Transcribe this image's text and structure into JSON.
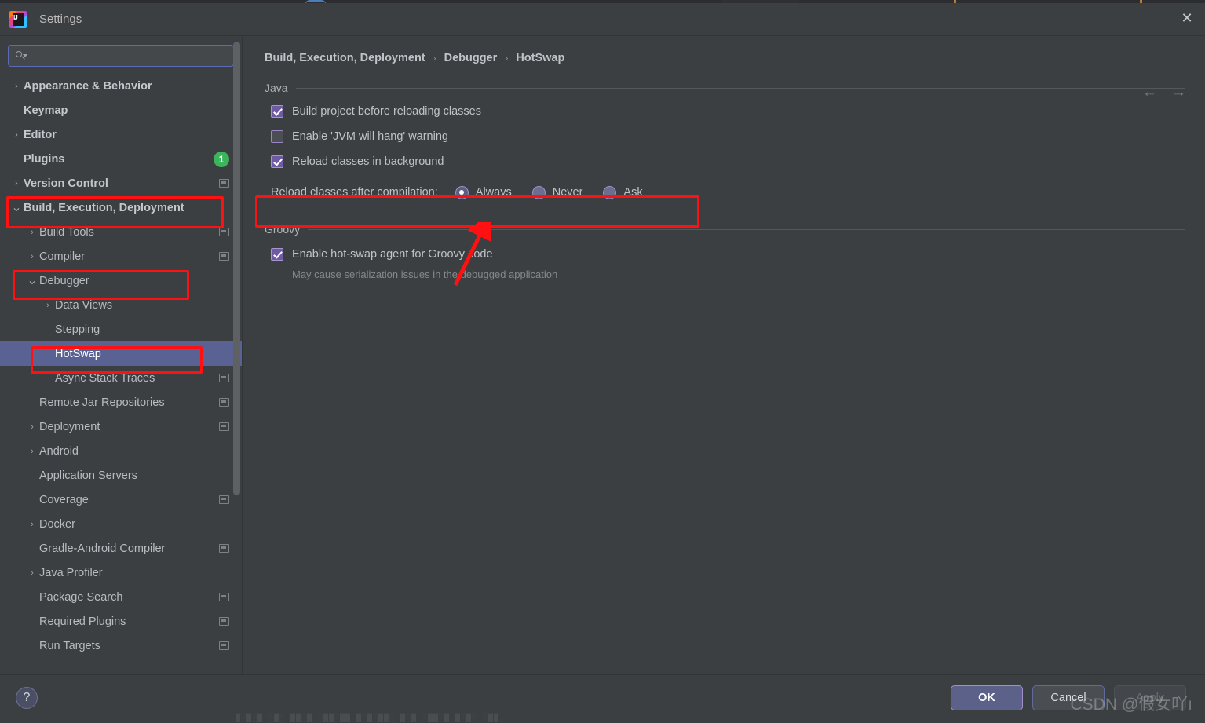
{
  "window": {
    "title": "Settings",
    "app_icon": "intellij-idea-icon",
    "close_icon": "close-icon"
  },
  "search": {
    "value": "",
    "placeholder": "",
    "icon": "search-icon"
  },
  "sidebar": {
    "items": [
      {
        "label": "Appearance & Behavior",
        "indent": 0,
        "arrow": "collapsed",
        "bold": true,
        "marker": false,
        "badge": null,
        "selected": false
      },
      {
        "label": "Keymap",
        "indent": 0,
        "arrow": "none",
        "bold": true,
        "marker": false,
        "badge": null,
        "selected": false
      },
      {
        "label": "Editor",
        "indent": 0,
        "arrow": "collapsed",
        "bold": true,
        "marker": false,
        "badge": null,
        "selected": false
      },
      {
        "label": "Plugins",
        "indent": 0,
        "arrow": "none",
        "bold": true,
        "marker": false,
        "badge": "1",
        "selected": false
      },
      {
        "label": "Version Control",
        "indent": 0,
        "arrow": "collapsed",
        "bold": true,
        "marker": true,
        "badge": null,
        "selected": false
      },
      {
        "label": "Build, Execution, Deployment",
        "indent": 0,
        "arrow": "expanded",
        "bold": true,
        "marker": false,
        "badge": null,
        "selected": false
      },
      {
        "label": "Build Tools",
        "indent": 1,
        "arrow": "collapsed",
        "bold": false,
        "marker": true,
        "badge": null,
        "selected": false
      },
      {
        "label": "Compiler",
        "indent": 1,
        "arrow": "collapsed",
        "bold": false,
        "marker": true,
        "badge": null,
        "selected": false
      },
      {
        "label": "Debugger",
        "indent": 1,
        "arrow": "expanded",
        "bold": false,
        "marker": false,
        "badge": null,
        "selected": false
      },
      {
        "label": "Data Views",
        "indent": 2,
        "arrow": "collapsed",
        "bold": false,
        "marker": false,
        "badge": null,
        "selected": false
      },
      {
        "label": "Stepping",
        "indent": 2,
        "arrow": "none",
        "bold": false,
        "marker": false,
        "badge": null,
        "selected": false
      },
      {
        "label": "HotSwap",
        "indent": 2,
        "arrow": "none",
        "bold": false,
        "marker": false,
        "badge": null,
        "selected": true
      },
      {
        "label": "Async Stack Traces",
        "indent": 2,
        "arrow": "none",
        "bold": false,
        "marker": true,
        "badge": null,
        "selected": false
      },
      {
        "label": "Remote Jar Repositories",
        "indent": 1,
        "arrow": "none",
        "bold": false,
        "marker": true,
        "badge": null,
        "selected": false
      },
      {
        "label": "Deployment",
        "indent": 1,
        "arrow": "collapsed",
        "bold": false,
        "marker": true,
        "badge": null,
        "selected": false
      },
      {
        "label": "Android",
        "indent": 1,
        "arrow": "collapsed",
        "bold": false,
        "marker": false,
        "badge": null,
        "selected": false
      },
      {
        "label": "Application Servers",
        "indent": 1,
        "arrow": "none",
        "bold": false,
        "marker": false,
        "badge": null,
        "selected": false
      },
      {
        "label": "Coverage",
        "indent": 1,
        "arrow": "none",
        "bold": false,
        "marker": true,
        "badge": null,
        "selected": false
      },
      {
        "label": "Docker",
        "indent": 1,
        "arrow": "collapsed",
        "bold": false,
        "marker": false,
        "badge": null,
        "selected": false
      },
      {
        "label": "Gradle-Android Compiler",
        "indent": 1,
        "arrow": "none",
        "bold": false,
        "marker": true,
        "badge": null,
        "selected": false
      },
      {
        "label": "Java Profiler",
        "indent": 1,
        "arrow": "collapsed",
        "bold": false,
        "marker": false,
        "badge": null,
        "selected": false
      },
      {
        "label": "Package Search",
        "indent": 1,
        "arrow": "none",
        "bold": false,
        "marker": true,
        "badge": null,
        "selected": false
      },
      {
        "label": "Required Plugins",
        "indent": 1,
        "arrow": "none",
        "bold": false,
        "marker": true,
        "badge": null,
        "selected": false
      },
      {
        "label": "Run Targets",
        "indent": 1,
        "arrow": "none",
        "bold": false,
        "marker": true,
        "badge": null,
        "selected": false
      }
    ]
  },
  "breadcrumb": {
    "parts": [
      "Build, Execution, Deployment",
      "Debugger",
      "HotSwap"
    ],
    "separator": "›",
    "back_icon": "arrow-left-icon",
    "forward_icon": "arrow-right-icon"
  },
  "java_section": {
    "title": "Java",
    "checkboxes": [
      {
        "label": "Build project before reloading classes",
        "checked": true,
        "mnemonic": ""
      },
      {
        "label": "Enable 'JVM will hang' warning",
        "checked": false,
        "mnemonic": ""
      },
      {
        "label": "Reload classes in background",
        "checked": true,
        "mnemonic": "b"
      }
    ],
    "radio_group": {
      "caption": "Reload classes after compilation:",
      "selected": "Always",
      "options": [
        {
          "label": "Always",
          "mnemonic": "A"
        },
        {
          "label": "Never",
          "mnemonic": "N"
        },
        {
          "label": "Ask",
          "mnemonic": "k"
        }
      ]
    }
  },
  "groovy_section": {
    "title": "Groovy",
    "checkbox": {
      "label": "Enable hot-swap agent for Groovy code",
      "checked": true
    },
    "hint": "May cause serialization issues in the debugged application"
  },
  "footer": {
    "help_label": "?",
    "ok_label": "OK",
    "cancel_label": "Cancel",
    "apply_label": "Apply"
  },
  "watermark": {
    "text": "CSDN @假女吖ı"
  },
  "colors": {
    "accent_purple": "#6f5ba3",
    "selection_blue": "#5a6293",
    "badge_green": "#3cb45c",
    "annotation_red": "#ff1111",
    "background": "#3c3f41"
  }
}
